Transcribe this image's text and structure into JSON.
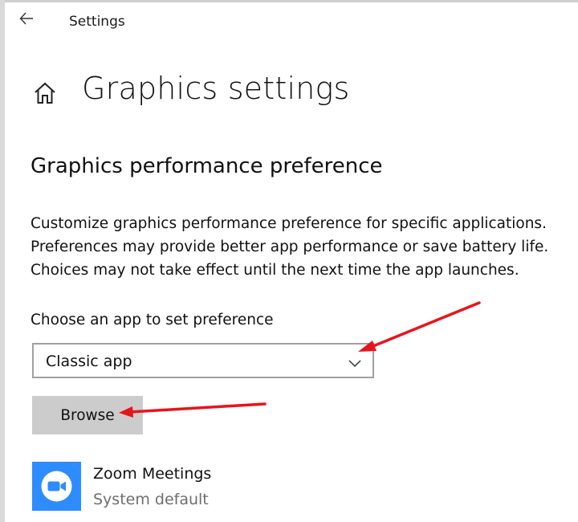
{
  "window": {
    "title": "Settings",
    "back_icon": "back-arrow-icon"
  },
  "page": {
    "home_icon": "home-icon",
    "title": "Graphics settings"
  },
  "section": {
    "title": "Graphics performance preference",
    "description_lines": [
      "Customize graphics performance preference for specific applications.",
      "Preferences may provide better app performance or save battery life.",
      "Choices may not take effect until the next time the app launches."
    ]
  },
  "app_chooser": {
    "label": "Choose an app to set preference",
    "selected": "Classic app",
    "chevron_icon": "chevron-down-icon"
  },
  "browse_button": {
    "label": "Browse"
  },
  "apps": [
    {
      "name": "Zoom Meetings",
      "status": "System default",
      "icon": "zoom-camera-icon",
      "icon_color": "#2D8CFF"
    }
  ],
  "annotation": {
    "arrow_color": "#E8141B",
    "arrow_icon": "red-arrow-icon"
  }
}
